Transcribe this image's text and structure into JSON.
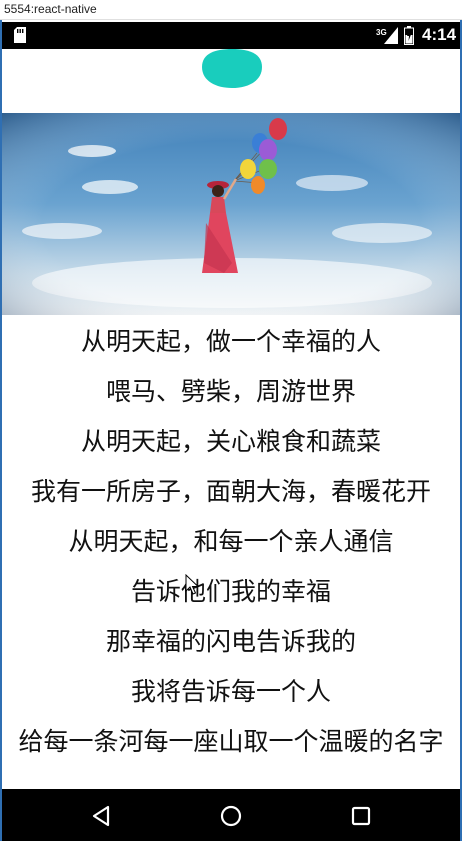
{
  "window": {
    "title": "5554:react-native"
  },
  "status_bar": {
    "time": "4:14",
    "network_label": "3G",
    "icons": [
      "sd-card-icon",
      "signal-icon",
      "battery-icon"
    ]
  },
  "colors": {
    "accent_teal": "#19cdbd",
    "status_bar_bg": "#000000",
    "nav_bar_bg": "#000000",
    "frame": "#2f6fb3"
  },
  "poem": {
    "lines": [
      "从明天起，做一个幸福的人",
      "喂马、劈柴，周游世界",
      "从明天起，关心粮食和蔬菜",
      "我有一所房子，面朝大海，春暖花开",
      "从明天起，和每一个亲人通信",
      "告诉他们我的幸福",
      "那幸福的闪电告诉我的",
      "我将告诉每一个人",
      "给每一条河每一座山取一个温暖的名字"
    ]
  },
  "nav_bar": {
    "icons": [
      "back-icon",
      "home-icon",
      "recent-apps-icon"
    ]
  }
}
